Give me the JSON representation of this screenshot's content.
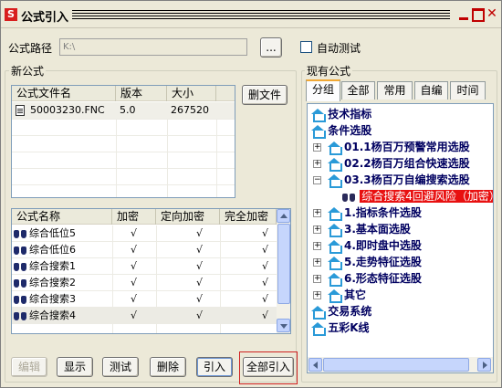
{
  "window": {
    "title": "公式引入"
  },
  "path": {
    "label": "公式路径",
    "value": "K:\\",
    "browse_label": "...",
    "auto_test_label": "自动测试"
  },
  "new_formula": {
    "group_title": "新公式",
    "delete_file_label": "删文件",
    "file_columns": [
      "公式文件名",
      "版本",
      "大小"
    ],
    "files": [
      {
        "name": "50003230.FNC",
        "version": "5.0",
        "size": "267520"
      }
    ],
    "formula_columns": [
      "公式名称",
      "加密",
      "定向加密",
      "完全加密"
    ],
    "formulas": [
      {
        "name": "综合低位5",
        "enc": "√",
        "dir": "√",
        "full": "√"
      },
      {
        "name": "综合低位6",
        "enc": "√",
        "dir": "√",
        "full": "√"
      },
      {
        "name": "综合搜索1",
        "enc": "√",
        "dir": "√",
        "full": "√"
      },
      {
        "name": "综合搜索2",
        "enc": "√",
        "dir": "√",
        "full": "√"
      },
      {
        "name": "综合搜索3",
        "enc": "√",
        "dir": "√",
        "full": "√"
      },
      {
        "name": "综合搜索4",
        "enc": "√",
        "dir": "√",
        "full": "√"
      }
    ]
  },
  "buttons": {
    "edit": "编辑",
    "show": "显示",
    "test": "测试",
    "delete": "删除",
    "import": "引入",
    "import_all": "全部引入"
  },
  "existing": {
    "group_title": "现有公式",
    "tabs": [
      "分组",
      "全部",
      "常用",
      "自编",
      "时间"
    ],
    "tree": [
      {
        "label": "技术指标"
      },
      {
        "label": "条件选股"
      },
      {
        "label": "01.1杨百万预警常用选股"
      },
      {
        "label": "02.2杨百万组合快速选股"
      },
      {
        "label": "03.3杨百万自编搜索选股"
      },
      {
        "label": "综合搜索4回避风险（加密）"
      },
      {
        "label": "1.指标条件选股"
      },
      {
        "label": "3.基本面选股"
      },
      {
        "label": "4.即时盘中选股"
      },
      {
        "label": "5.走势特征选股"
      },
      {
        "label": "6.形态特征选股"
      },
      {
        "label": "其它"
      },
      {
        "label": "交易系统"
      },
      {
        "label": "五彩K线"
      }
    ]
  },
  "colors": {
    "accent": "#e81010",
    "tree_text": "#000060",
    "window_bg": "#ece9d8"
  }
}
